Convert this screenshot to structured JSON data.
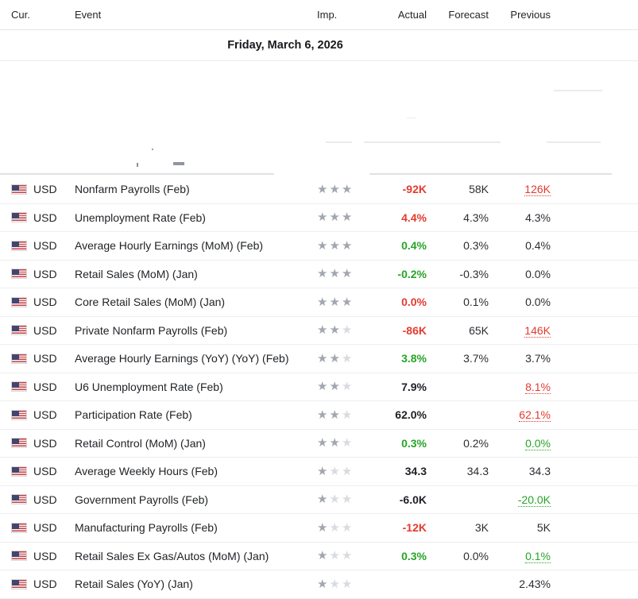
{
  "header": {
    "columns": {
      "currency": "Cur.",
      "event": "Event",
      "importance": "Imp.",
      "actual": "Actual",
      "forecast": "Forecast",
      "previous": "Previous"
    }
  },
  "date_row": {
    "label": "Friday, March 6, 2026"
  },
  "colors": {
    "positive_green": "#27a427",
    "negative_red": "#e23b30",
    "text": "#232629",
    "star_filled": "#a2a6ae",
    "star_empty": "#d9dbe0",
    "row_border": "#eceef0"
  },
  "rows": [
    {
      "currency": "USD",
      "flag": "us-flag",
      "event": "Nonfarm Payrolls (Feb)",
      "importance": 3,
      "actual": {
        "text": "-92K",
        "color": "red"
      },
      "forecast": {
        "text": "58K"
      },
      "previous": {
        "text": "126K",
        "color": "red",
        "revised": true
      }
    },
    {
      "currency": "USD",
      "flag": "us-flag",
      "event": "Unemployment Rate (Feb)",
      "importance": 3,
      "actual": {
        "text": "4.4%",
        "color": "red"
      },
      "forecast": {
        "text": "4.3%"
      },
      "previous": {
        "text": "4.3%"
      }
    },
    {
      "currency": "USD",
      "flag": "us-flag",
      "event": "Average Hourly Earnings (MoM) (Feb)",
      "importance": 3,
      "actual": {
        "text": "0.4%",
        "color": "green"
      },
      "forecast": {
        "text": "0.3%"
      },
      "previous": {
        "text": "0.4%"
      }
    },
    {
      "currency": "USD",
      "flag": "us-flag",
      "event": "Retail Sales (MoM) (Jan)",
      "importance": 3,
      "actual": {
        "text": "-0.2%",
        "color": "green"
      },
      "forecast": {
        "text": "-0.3%"
      },
      "previous": {
        "text": "0.0%"
      }
    },
    {
      "currency": "USD",
      "flag": "us-flag",
      "event": "Core Retail Sales (MoM) (Jan)",
      "importance": 3,
      "actual": {
        "text": "0.0%",
        "color": "red"
      },
      "forecast": {
        "text": "0.1%"
      },
      "previous": {
        "text": "0.0%"
      }
    },
    {
      "currency": "USD",
      "flag": "us-flag",
      "event": "Private Nonfarm Payrolls (Feb)",
      "importance": 2,
      "actual": {
        "text": "-86K",
        "color": "red"
      },
      "forecast": {
        "text": "65K"
      },
      "previous": {
        "text": "146K",
        "color": "red",
        "revised": true
      }
    },
    {
      "currency": "USD",
      "flag": "us-flag",
      "event": "Average Hourly Earnings (YoY) (YoY) (Feb)",
      "importance": 2,
      "actual": {
        "text": "3.8%",
        "color": "green"
      },
      "forecast": {
        "text": "3.7%"
      },
      "previous": {
        "text": "3.7%"
      }
    },
    {
      "currency": "USD",
      "flag": "us-flag",
      "event": "U6 Unemployment Rate (Feb)",
      "importance": 2,
      "actual": {
        "text": "7.9%",
        "color": "black"
      },
      "forecast": {
        "text": ""
      },
      "previous": {
        "text": "8.1%",
        "color": "red",
        "revised": true
      }
    },
    {
      "currency": "USD",
      "flag": "us-flag",
      "event": "Participation Rate (Feb)",
      "importance": 2,
      "actual": {
        "text": "62.0%",
        "color": "black"
      },
      "forecast": {
        "text": ""
      },
      "previous": {
        "text": "62.1%",
        "color": "red",
        "revised": true
      }
    },
    {
      "currency": "USD",
      "flag": "us-flag",
      "event": "Retail Control (MoM) (Jan)",
      "importance": 2,
      "actual": {
        "text": "0.3%",
        "color": "green"
      },
      "forecast": {
        "text": "0.2%"
      },
      "previous": {
        "text": "0.0%",
        "color": "green",
        "revised": true
      }
    },
    {
      "currency": "USD",
      "flag": "us-flag",
      "event": "Average Weekly Hours (Feb)",
      "importance": 1,
      "actual": {
        "text": "34.3",
        "color": "black"
      },
      "forecast": {
        "text": "34.3"
      },
      "previous": {
        "text": "34.3"
      }
    },
    {
      "currency": "USD",
      "flag": "us-flag",
      "event": "Government Payrolls (Feb)",
      "importance": 1,
      "actual": {
        "text": "-6.0K",
        "color": "black"
      },
      "forecast": {
        "text": ""
      },
      "previous": {
        "text": "-20.0K",
        "color": "green",
        "revised": true
      }
    },
    {
      "currency": "USD",
      "flag": "us-flag",
      "event": "Manufacturing Payrolls (Feb)",
      "importance": 1,
      "actual": {
        "text": "-12K",
        "color": "red"
      },
      "forecast": {
        "text": "3K"
      },
      "previous": {
        "text": "5K"
      }
    },
    {
      "currency": "USD",
      "flag": "us-flag",
      "event": "Retail Sales Ex Gas/Autos (MoM) (Jan)",
      "importance": 1,
      "actual": {
        "text": "0.3%",
        "color": "green"
      },
      "forecast": {
        "text": "0.0%"
      },
      "previous": {
        "text": "0.1%",
        "color": "green",
        "revised": true
      }
    },
    {
      "currency": "USD",
      "flag": "us-flag",
      "event": "Retail Sales (YoY) (Jan)",
      "importance": 1,
      "actual": {
        "text": ""
      },
      "forecast": {
        "text": ""
      },
      "previous": {
        "text": "2.43%"
      }
    }
  ]
}
